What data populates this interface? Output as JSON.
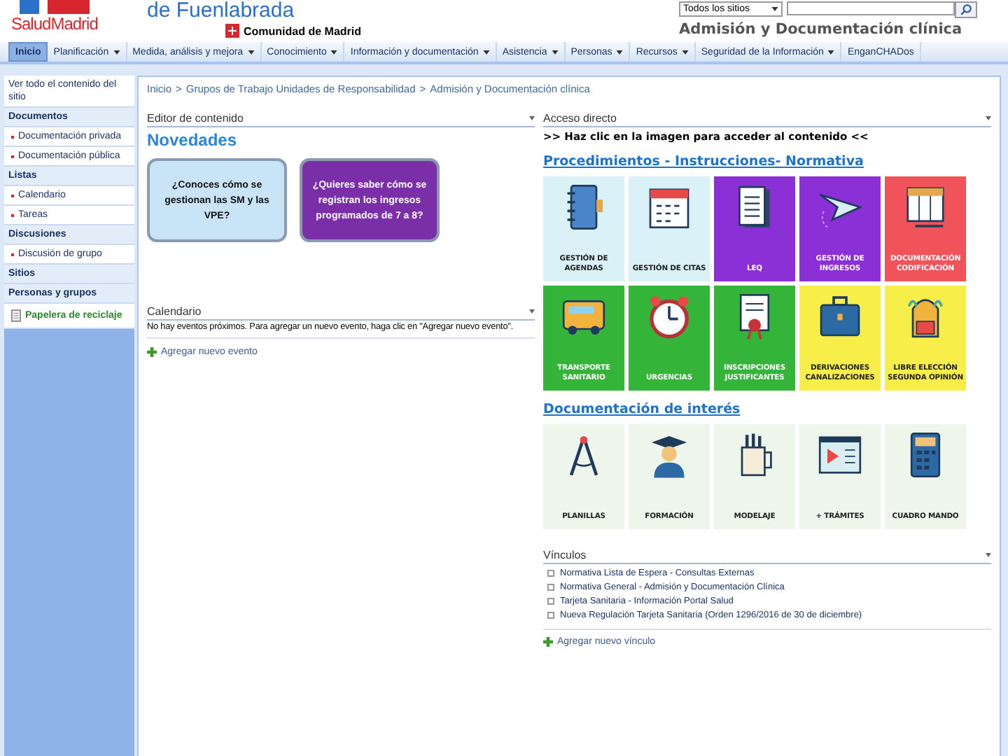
{
  "header": {
    "logo_text": "SaludMadrid",
    "site_name": "de Fuenlabrada",
    "org": "Comunidad de Madrid",
    "search_scope": "Todos los sitios",
    "page_title": "Admisión y Documentación clínica"
  },
  "nav": [
    {
      "label": "Inicio",
      "selected": true,
      "dropdown": false
    },
    {
      "label": "Planificación",
      "selected": false,
      "dropdown": true
    },
    {
      "label": "Medida, análisis y mejora",
      "selected": false,
      "dropdown": true
    },
    {
      "label": "Conocimiento",
      "selected": false,
      "dropdown": true
    },
    {
      "label": "Información y documentación",
      "selected": false,
      "dropdown": true
    },
    {
      "label": "Asistencia",
      "selected": false,
      "dropdown": true
    },
    {
      "label": "Personas",
      "selected": false,
      "dropdown": true
    },
    {
      "label": "Recursos",
      "selected": false,
      "dropdown": true
    },
    {
      "label": "Seguridad de la Información",
      "selected": false,
      "dropdown": true
    },
    {
      "label": "EnganCHADos",
      "selected": false,
      "dropdown": false
    }
  ],
  "sidebar": [
    {
      "kind": "link",
      "label": "Ver todo el contenido del sitio"
    },
    {
      "kind": "heading",
      "label": "Documentos"
    },
    {
      "kind": "item",
      "label": "Documentación privada"
    },
    {
      "kind": "item",
      "label": "Documentación pública"
    },
    {
      "kind": "heading",
      "label": "Listas"
    },
    {
      "kind": "item",
      "label": "Calendario"
    },
    {
      "kind": "item",
      "label": "Tareas"
    },
    {
      "kind": "heading",
      "label": "Discusiones"
    },
    {
      "kind": "item",
      "label": "Discusión de grupo"
    },
    {
      "kind": "heading",
      "label": "Sitios"
    },
    {
      "kind": "heading",
      "label": "Personas y grupos"
    },
    {
      "kind": "recycle",
      "label": "Papelera de reciclaje"
    }
  ],
  "breadcrumb": [
    "Inicio",
    "Grupos de Trabajo Unidades de Responsabilidad",
    "Admisión y Documentación clínica"
  ],
  "breadcrumb_separator": ">",
  "editor": {
    "title": "Editor de contenido",
    "heading": "Novedades",
    "cards": [
      {
        "text": "¿Conoces cómo se gestionan las SM y las VPE?",
        "color": "#c9e4f7"
      },
      {
        "text": "¿Quieres saber cómo se registran los ingresos programados de 7 a 8?",
        "color": "#7a2fa8"
      }
    ]
  },
  "calendar": {
    "title": "Calendario",
    "message": "No hay eventos próximos. Para agregar un nuevo evento, haga clic en \"Agregar nuevo evento\".",
    "add_link": "Agregar nuevo evento"
  },
  "access": {
    "title": "Acceso directo",
    "instruction": ">> Haz clic en la imagen para acceder al contenido <<",
    "sections": [
      {
        "title": "Procedimientos - Instrucciones- Normativa",
        "tiles": [
          {
            "kind": "agenda",
            "label": "GESTIÓN DE AGENDAS",
            "color": "#d9f1f7"
          },
          {
            "kind": "calendar",
            "label": "GESTIÓN DE CITAS",
            "color": "#d9f1f7"
          },
          {
            "kind": "document",
            "label": "LEQ",
            "color": "#8b2fd6"
          },
          {
            "kind": "plane",
            "label": "GESTIÓN DE INGRESOS",
            "color": "#8b2fd6"
          },
          {
            "kind": "table",
            "label": "DOCUMENTACIÓN CODIFICACIÓN",
            "color": "#f0545a"
          },
          {
            "kind": "bus",
            "label": "TRANSPORTE SANITARIO",
            "color": "#35b43a"
          },
          {
            "kind": "clock",
            "label": "URGENCIAS",
            "color": "#35b43a"
          },
          {
            "kind": "certificate",
            "label": "INSCRIPCIONES JUSTIFICANTES",
            "color": "#35b43a"
          },
          {
            "kind": "briefcase",
            "label": "DERIVACIONES CANALIZACIONES",
            "color": "#f7ee4a"
          },
          {
            "kind": "backpack",
            "label": "LIBRE ELECCIÓN SEGUNDA OPINIÓN",
            "color": "#f7ee4a"
          }
        ]
      },
      {
        "title": "Documentación de interés",
        "tiles": [
          {
            "kind": "compass",
            "label": "PLANILLAS",
            "color": "#eef5ea"
          },
          {
            "kind": "graduate",
            "label": "FORMACIÓN",
            "color": "#eef5ea"
          },
          {
            "kind": "mug",
            "label": "MODELAJE",
            "color": "#eef5ea"
          },
          {
            "kind": "video",
            "label": "+ TRÁMITES",
            "color": "#eef5ea"
          },
          {
            "kind": "calculator",
            "label": "CUADRO MANDO",
            "color": "#eef5ea"
          }
        ]
      }
    ]
  },
  "links": {
    "title": "Vínculos",
    "items": [
      "Normativa Lista de Espera - Consultas Externas",
      "Normativa General - Admisión y Documentación Clínica",
      "Tarjeta Sanitaria - Información Portal Salud",
      "Nueva Regulación Tarjeta Sanitaria (Orden 1296/2016 de 30 de diciembre)"
    ],
    "add_link": "Agregar nuevo vínculo"
  }
}
